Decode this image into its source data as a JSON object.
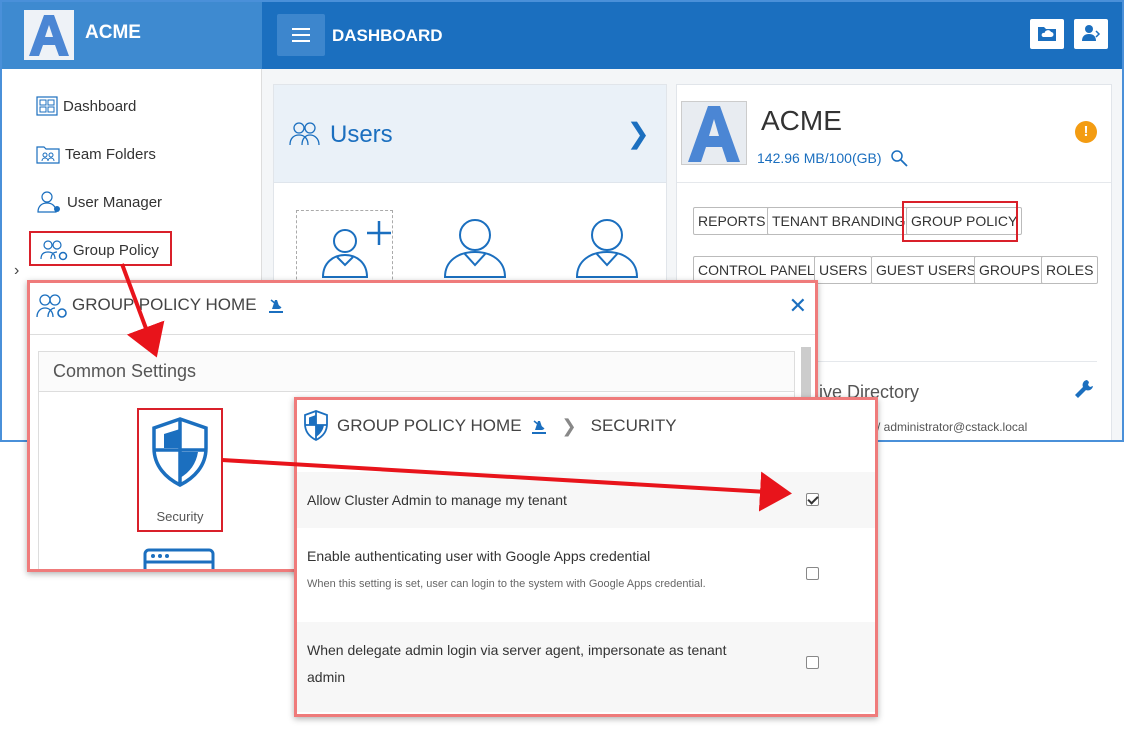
{
  "app": {
    "brand_name": "ACME",
    "topbar_title": "DASHBOARD",
    "icons": {
      "hamburger": "menu-icon",
      "cloud": "cloud-folder-icon",
      "user": "user-logout-icon"
    }
  },
  "sidebar": {
    "items": [
      {
        "label": "Dashboard",
        "icon": "dashboard-icon"
      },
      {
        "label": "Team Folders",
        "icon": "team-folder-icon"
      },
      {
        "label": "User Manager",
        "icon": "user-manager-icon"
      },
      {
        "label": "Group Policy",
        "icon": "group-policy-icon"
      }
    ]
  },
  "users_card": {
    "title": "Users"
  },
  "tenant": {
    "name": "ACME",
    "storage": "142.96 MB/100(GB)",
    "buttons_row1": [
      "REPORTS",
      "TENANT BRANDING",
      "GROUP POLICY"
    ],
    "buttons_row2": [
      "CONTROL PANEL",
      "USERS",
      "GUEST USERS",
      "GROUPS",
      "ROLES"
    ],
    "ad_title": "ive Directory",
    "ad_sub": "/ administrator@cstack.local"
  },
  "gp_dialog": {
    "title": "GROUP POLICY HOME",
    "section": "Common Settings",
    "security_label": "Security"
  },
  "sec_dialog": {
    "title_home": "GROUP POLICY HOME",
    "title_current": "SECURITY",
    "settings": [
      {
        "label": "Allow Cluster Admin to manage my tenant",
        "help": "",
        "checked": true
      },
      {
        "label": "Enable authenticating user with Google Apps credential",
        "help": "When this setting is set, user can login to the system with Google Apps credential.",
        "checked": false
      },
      {
        "label": "When delegate admin login via server agent, impersonate as tenant",
        "label2": "admin",
        "help": "",
        "checked": false
      }
    ]
  },
  "colors": {
    "brand_blue": "#1b6fbf",
    "sidebar_brand": "#3e8ad0",
    "highlight_red": "#d9202a",
    "warning": "#f39c12"
  }
}
